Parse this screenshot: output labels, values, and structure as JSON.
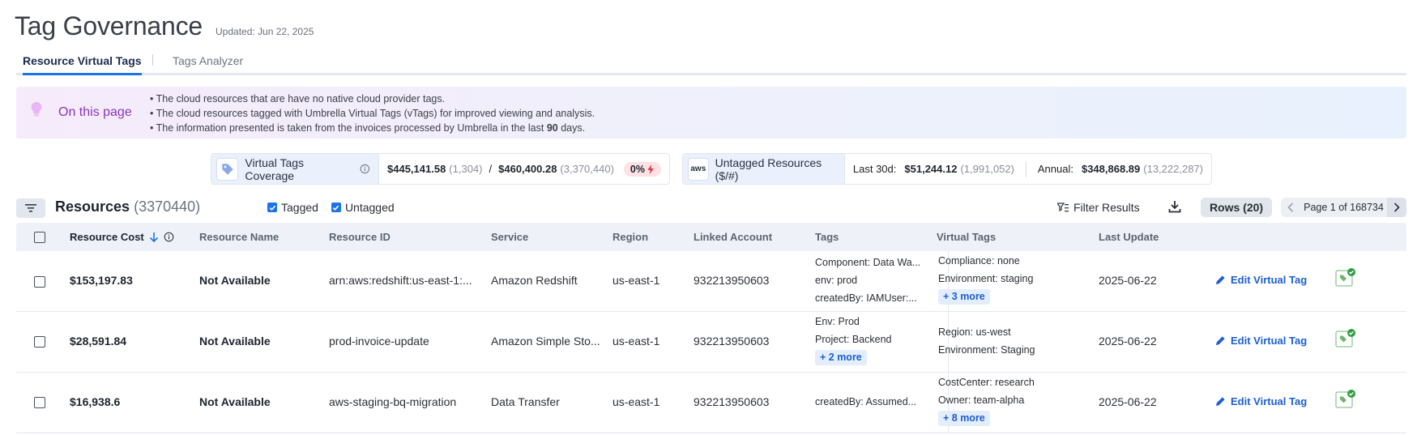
{
  "header": {
    "title": "Tag Governance",
    "updated": "Updated: Jun 22, 2025"
  },
  "tabs": [
    {
      "label": "Resource Virtual Tags",
      "active": true
    },
    {
      "label": "Tags Analyzer",
      "active": false
    }
  ],
  "info": {
    "title": "On this page",
    "lines": [
      {
        "prefix": "• The cloud resources that are have no native cloud provider tags.",
        "bold": "",
        "suffix": ""
      },
      {
        "prefix": "• The cloud resources tagged with Umbrella Virtual Tags (vTags) for improved viewing and analysis.",
        "bold": "",
        "suffix": ""
      },
      {
        "prefix": "• The information presented is taken from the invoices processed by Umbrella in the last ",
        "bold": "90",
        "suffix": " days."
      }
    ]
  },
  "coverage": {
    "label": "Virtual Tags Coverage",
    "value1": "$445,141.58",
    "count1": "(1,304)",
    "slash": "/",
    "value2": "$460,400.28",
    "count2": "(3,370,440)",
    "percent": "0%"
  },
  "untagged": {
    "badge": "aws",
    "label": "Untagged Resources ($/#)",
    "last30_label": "Last 30d:",
    "last30_value": "$51,244.12",
    "last30_count": "(1,991,052)",
    "annual_label": "Annual:",
    "annual_value": "$348,868.89",
    "annual_count": "(13,222,287)"
  },
  "toolbar": {
    "title": "Resources",
    "count": "(3370440)",
    "tagged_label": "Tagged",
    "untagged_label": "Untagged",
    "filter_results": "Filter Results",
    "rows_label": "Rows (20)",
    "page_label": "Page 1 of 168734"
  },
  "columns": [
    "Resource Cost",
    "Resource Name",
    "Resource ID",
    "Service",
    "Region",
    "Linked Account",
    "Tags",
    "Virtual Tags",
    "Last Update"
  ],
  "edit_label": "Edit Virtual Tag",
  "rows": [
    {
      "cost": "$153,197.83",
      "name": "Not Available",
      "id": "arn:aws:redshift:us-east-1:...",
      "service": "Amazon Redshift",
      "region": "us-east-1",
      "account": "932213950603",
      "tags": [
        "Component: Data Wa...",
        "env: prod",
        "createdBy: IAMUser:..."
      ],
      "tags_more": "",
      "vtags": [
        "Compliance: none",
        "Environment: staging"
      ],
      "vtags_more": "+ 3 more",
      "updated": "2025-06-22"
    },
    {
      "cost": "$28,591.84",
      "name": "Not Available",
      "id": "prod-invoice-update",
      "service": "Amazon Simple Sto...",
      "region": "us-east-1",
      "account": "932213950603",
      "tags": [
        "Env: Prod",
        "Project: Backend"
      ],
      "tags_more": "+ 2 more",
      "vtags": [
        "Region: us-west",
        "Environment: Staging"
      ],
      "vtags_more": "",
      "updated": "2025-06-22"
    },
    {
      "cost": "$16,938.6",
      "name": "Not Available",
      "id": "aws-staging-bq-migration",
      "service": "Data Transfer",
      "region": "us-east-1",
      "account": "932213950603",
      "tags": [
        "createdBy: Assumed..."
      ],
      "tags_more": "",
      "vtags": [
        "CostCenter: research",
        "Owner: team-alpha"
      ],
      "vtags_more": "+ 8 more",
      "updated": "2025-06-22"
    }
  ]
}
